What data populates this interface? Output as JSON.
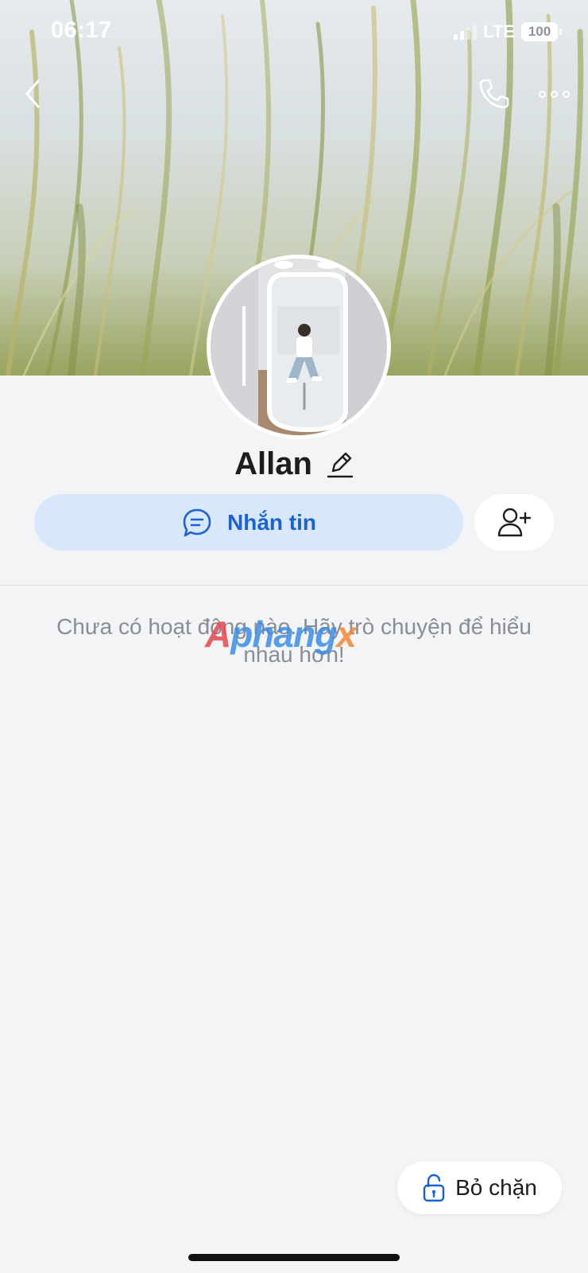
{
  "status_bar": {
    "time": "06:17",
    "network": "LTE",
    "battery": "100"
  },
  "header": {
    "back_icon": "chevron-left-icon",
    "call_icon": "phone-icon",
    "more_icon": "more-horizontal-icon"
  },
  "profile": {
    "name": "Allan",
    "edit_icon": "pencil-icon"
  },
  "actions": {
    "message_label": "Nhắn tin",
    "message_icon": "chat-bubble-icon",
    "add_friend_icon": "add-user-icon"
  },
  "feed": {
    "empty_message": "Chưa có hoạt động nào. Hãy trò chuyện để hiểu nhau hơn!"
  },
  "watermark": {
    "part1": "A",
    "part2": "phang",
    "part3": "x"
  },
  "footer": {
    "unblock_label": "Bỏ chặn",
    "unblock_icon": "unlock-icon"
  },
  "colors": {
    "accent": "#1a62d8",
    "message_bg": "#d9e7fb",
    "page_bg": "#f3f4f6"
  }
}
